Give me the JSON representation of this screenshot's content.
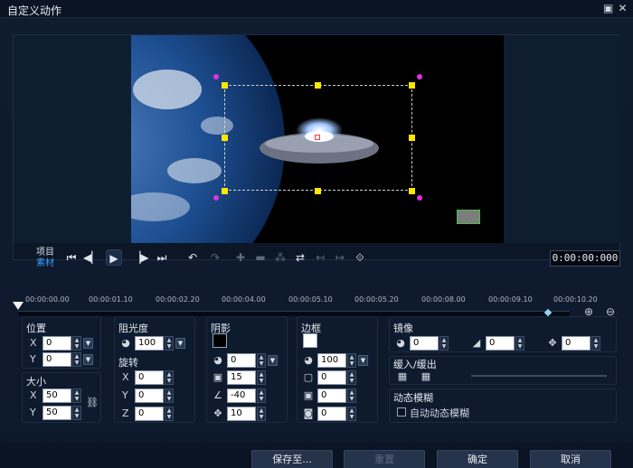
{
  "window": {
    "title": "自定义动作",
    "maximize_icon": "maximize-icon",
    "close_icon": "close-icon"
  },
  "playback": {
    "mode_project": "项目",
    "mode_clip": "素材",
    "timecode": "0:00:00:000",
    "active_mode_color": "#3aa0ff"
  },
  "timeline": {
    "ticks": [
      "00:00:00.00",
      "00:00:01.10",
      "00:00:02.20",
      "00:00:04.00",
      "00:00:05.10",
      "00:00:05.20",
      "00:00:08.00",
      "00:00:09.10",
      "00:00:10.20"
    ],
    "playhead_fraction": 0.0,
    "keyframe_fraction": 0.96
  },
  "position": {
    "title": "位置",
    "x_label": "X",
    "x": "0",
    "y_label": "Y",
    "y": "0"
  },
  "size": {
    "title": "大小",
    "x_label": "X",
    "x": "50",
    "y_label": "Y",
    "y": "50"
  },
  "opacity": {
    "title": "阻光度",
    "value": "100"
  },
  "rotation": {
    "title": "旋转",
    "x_label": "X",
    "x": "0",
    "y_label": "Y",
    "y": "0",
    "z_label": "Z",
    "z": "0"
  },
  "shadow": {
    "title": "阴影",
    "color": "#000000",
    "opacity": "0",
    "blur": "15",
    "direction": "-40",
    "distance": "10"
  },
  "border": {
    "title": "边框",
    "color": "#ffffff",
    "opacity": "100",
    "width": "0",
    "blur": "0",
    "extra": "0"
  },
  "mirror": {
    "title": "镜像",
    "value1": "0",
    "value2": "0",
    "value3": "0"
  },
  "ease": {
    "title": "缓入/缓出"
  },
  "motion_blur": {
    "title": "动态模糊",
    "auto_label": "自动动态模糊",
    "auto_checked": false
  },
  "buttons": {
    "save_to": "保存至...",
    "reset": "重置",
    "ok": "确定",
    "cancel": "取消"
  }
}
